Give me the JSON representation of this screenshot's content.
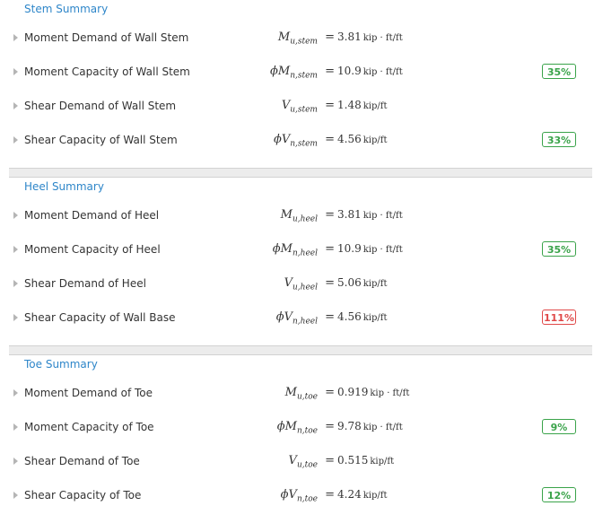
{
  "sections": [
    {
      "title": "Stem Summary",
      "rows": [
        {
          "label": "Moment Demand of Wall Stem",
          "phi": "",
          "sym": "M",
          "sub": "u,stem",
          "value": "3.81",
          "unit": "kip · ft/ft",
          "badge": ""
        },
        {
          "label": "Moment Capacity of Wall Stem",
          "phi": "ϕ",
          "sym": "M",
          "sub": "n,stem",
          "value": "10.9",
          "unit": "kip · ft/ft",
          "badge": "35%"
        },
        {
          "label": "Shear Demand of Wall Stem",
          "phi": "",
          "sym": "V",
          "sub": "u,stem",
          "value": "1.48",
          "unit": "kip/ft",
          "badge": ""
        },
        {
          "label": "Shear Capacity of Wall Stem",
          "phi": "ϕ",
          "sym": "V",
          "sub": "n,stem",
          "value": "4.56",
          "unit": "kip/ft",
          "badge": "33%"
        }
      ]
    },
    {
      "title": "Heel Summary",
      "rows": [
        {
          "label": "Moment Demand of Heel",
          "phi": "",
          "sym": "M",
          "sub": "u,heel",
          "value": "3.81",
          "unit": "kip · ft/ft",
          "badge": ""
        },
        {
          "label": "Moment Capacity of Heel",
          "phi": "ϕ",
          "sym": "M",
          "sub": "n,heel",
          "value": "10.9",
          "unit": "kip · ft/ft",
          "badge": "35%"
        },
        {
          "label": "Shear Demand of Heel",
          "phi": "",
          "sym": "V",
          "sub": "u,heel",
          "value": "5.06",
          "unit": "kip/ft",
          "badge": ""
        },
        {
          "label": "Shear Capacity of Wall Base",
          "phi": "ϕ",
          "sym": "V",
          "sub": "n,heel",
          "value": "4.56",
          "unit": "kip/ft",
          "badge": "111%"
        }
      ]
    },
    {
      "title": "Toe Summary",
      "rows": [
        {
          "label": "Moment Demand of Toe",
          "phi": "",
          "sym": "M",
          "sub": "u,toe",
          "value": "0.919",
          "unit": "kip · ft/ft",
          "badge": ""
        },
        {
          "label": "Moment Capacity of Toe",
          "phi": "ϕ",
          "sym": "M",
          "sub": "n,toe",
          "value": "9.78",
          "unit": "kip · ft/ft",
          "badge": "9%"
        },
        {
          "label": "Shear Demand of Toe",
          "phi": "",
          "sym": "V",
          "sub": "u,toe",
          "value": "0.515",
          "unit": "kip/ft",
          "badge": ""
        },
        {
          "label": "Shear Capacity of Toe",
          "phi": "ϕ",
          "sym": "V",
          "sub": "n,toe",
          "value": "4.24",
          "unit": "kip/ft",
          "badge": "12%"
        }
      ]
    }
  ],
  "colors": {
    "accent": "#2e86c9",
    "ok": "#3aa34a",
    "fail": "#e04848"
  }
}
